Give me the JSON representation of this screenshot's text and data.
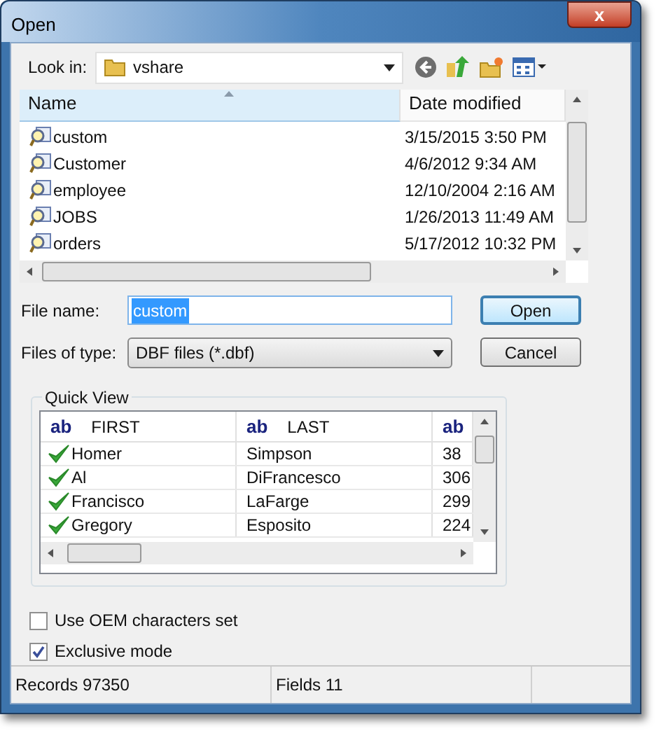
{
  "window": {
    "title": "Open",
    "close_glyph": "x"
  },
  "look_in": {
    "label": "Look in:",
    "value": "vshare"
  },
  "file_list": {
    "columns": [
      {
        "label": "Name",
        "sorted": true
      },
      {
        "label": "Date modified",
        "sorted": false
      }
    ],
    "rows": [
      {
        "name": "custom",
        "date": "3/15/2015 3:50 PM"
      },
      {
        "name": "Customer",
        "date": "4/6/2012 9:34 AM"
      },
      {
        "name": "employee",
        "date": "12/10/2004 2:16 AM"
      },
      {
        "name": "JOBS",
        "date": "1/26/2013 11:49 AM"
      },
      {
        "name": "orders",
        "date": "5/17/2012 10:32 PM"
      }
    ]
  },
  "file_name": {
    "label": "File name:",
    "value": "custom",
    "value_selected": true
  },
  "files_of_type": {
    "label": "Files of type:",
    "value": "DBF files (*.dbf)"
  },
  "buttons": [
    {
      "label": "Open",
      "default": true
    },
    {
      "label": "Cancel",
      "default": false
    }
  ],
  "quick_view": {
    "title": "Quick View",
    "columns": [
      {
        "type_badge": "ab",
        "label": "FIRST"
      },
      {
        "type_badge": "ab",
        "label": "LAST"
      },
      {
        "type_badge": "ab"
      }
    ],
    "rows": [
      {
        "checked": true,
        "cells": [
          "Homer",
          "Simpson",
          "38"
        ]
      },
      {
        "checked": true,
        "cells": [
          "Al",
          "DiFrancesco",
          "306"
        ]
      },
      {
        "checked": true,
        "cells": [
          "Francisco",
          "LaFarge",
          "299"
        ]
      },
      {
        "checked": true,
        "cells": [
          "Gregory",
          "Esposito",
          "224"
        ]
      }
    ]
  },
  "options": [
    {
      "label": "Use OEM characters set",
      "checked": false
    },
    {
      "label": "Exclusive mode",
      "checked": true
    }
  ],
  "status_bar": [
    "Records 97350",
    "Fields 11"
  ]
}
